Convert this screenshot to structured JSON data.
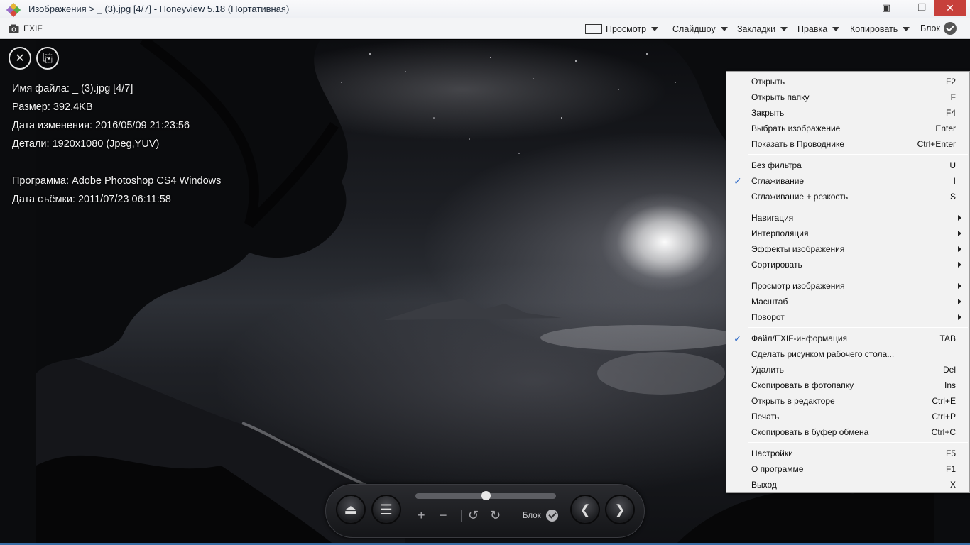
{
  "window": {
    "title": "Изображения > _ (3).jpg [4/7] - Honeyview 5.18 (Портативная)",
    "close_symbol": "✕",
    "min_symbol": "–",
    "max_symbol": "❐",
    "pin_symbol": "▣"
  },
  "toolbar": {
    "exif_label": "EXIF",
    "menus": [
      {
        "label": "Просмотр"
      },
      {
        "label": "Слайдшоу"
      },
      {
        "label": "Закладки"
      },
      {
        "label": "Правка"
      },
      {
        "label": "Копировать"
      },
      {
        "label": "Блок"
      }
    ]
  },
  "overlay": {
    "close_symbol": "✕",
    "copy_symbol": "⎘",
    "lines": [
      "Имя файла: _ (3).jpg [4/7]",
      "Размер: 392.4KB",
      "Дата изменения: 2016/05/09 21:23:56",
      "Детали: 1920x1080 (Jpeg,YUV)",
      "",
      "Программа: Adobe Photoshop CS4 Windows",
      "Дата съёмки: 2011/07/23 06:11:58"
    ]
  },
  "controller": {
    "slider_position_pct": 50,
    "eject_symbol": "⏏",
    "menu_symbol": "☰",
    "zoom_in_symbol": "+",
    "zoom_out_symbol": "−",
    "rotate_left_symbol": "↺",
    "rotate_right_symbol": "↻",
    "block_label": "Блок",
    "prev_symbol": "❮",
    "next_symbol": "❯"
  },
  "context_menu": {
    "groups": [
      [
        {
          "label": "Открыть",
          "shortcut": "F2"
        },
        {
          "label": "Открыть папку",
          "shortcut": "F"
        },
        {
          "label": "Закрыть",
          "shortcut": "F4"
        },
        {
          "label": "Выбрать изображение",
          "shortcut": "Enter"
        },
        {
          "label": "Показать в Проводнике",
          "shortcut": "Ctrl+Enter"
        }
      ],
      [
        {
          "label": "Без фильтра",
          "shortcut": "U"
        },
        {
          "label": "Сглаживание",
          "shortcut": "I",
          "checked": true
        },
        {
          "label": "Сглаживание + резкость",
          "shortcut": "S"
        }
      ],
      [
        {
          "label": "Навигация",
          "submenu": true
        },
        {
          "label": "Интерполяция",
          "submenu": true
        },
        {
          "label": "Эффекты изображения",
          "submenu": true
        },
        {
          "label": "Сортировать",
          "submenu": true
        }
      ],
      [
        {
          "label": "Просмотр изображения",
          "submenu": true
        },
        {
          "label": "Масштаб",
          "submenu": true
        },
        {
          "label": "Поворот",
          "submenu": true
        }
      ],
      [
        {
          "label": "Файл/EXIF-информация",
          "shortcut": "TAB",
          "checked": true
        },
        {
          "label": "Сделать рисунком рабочего стола...",
          "shortcut": ""
        },
        {
          "label": "Удалить",
          "shortcut": "Del"
        },
        {
          "label": "Скопировать в фотопапку",
          "shortcut": "Ins"
        },
        {
          "label": "Открыть в редакторе",
          "shortcut": "Ctrl+E"
        },
        {
          "label": "Печать",
          "shortcut": "Ctrl+P"
        },
        {
          "label": "Скопировать в буфер обмена",
          "shortcut": "Ctrl+C"
        }
      ],
      [
        {
          "label": "Настройки",
          "shortcut": "F5"
        },
        {
          "label": "О программе",
          "shortcut": "F1"
        },
        {
          "label": "Выход",
          "shortcut": "X"
        }
      ]
    ],
    "check_symbol": "✓"
  }
}
